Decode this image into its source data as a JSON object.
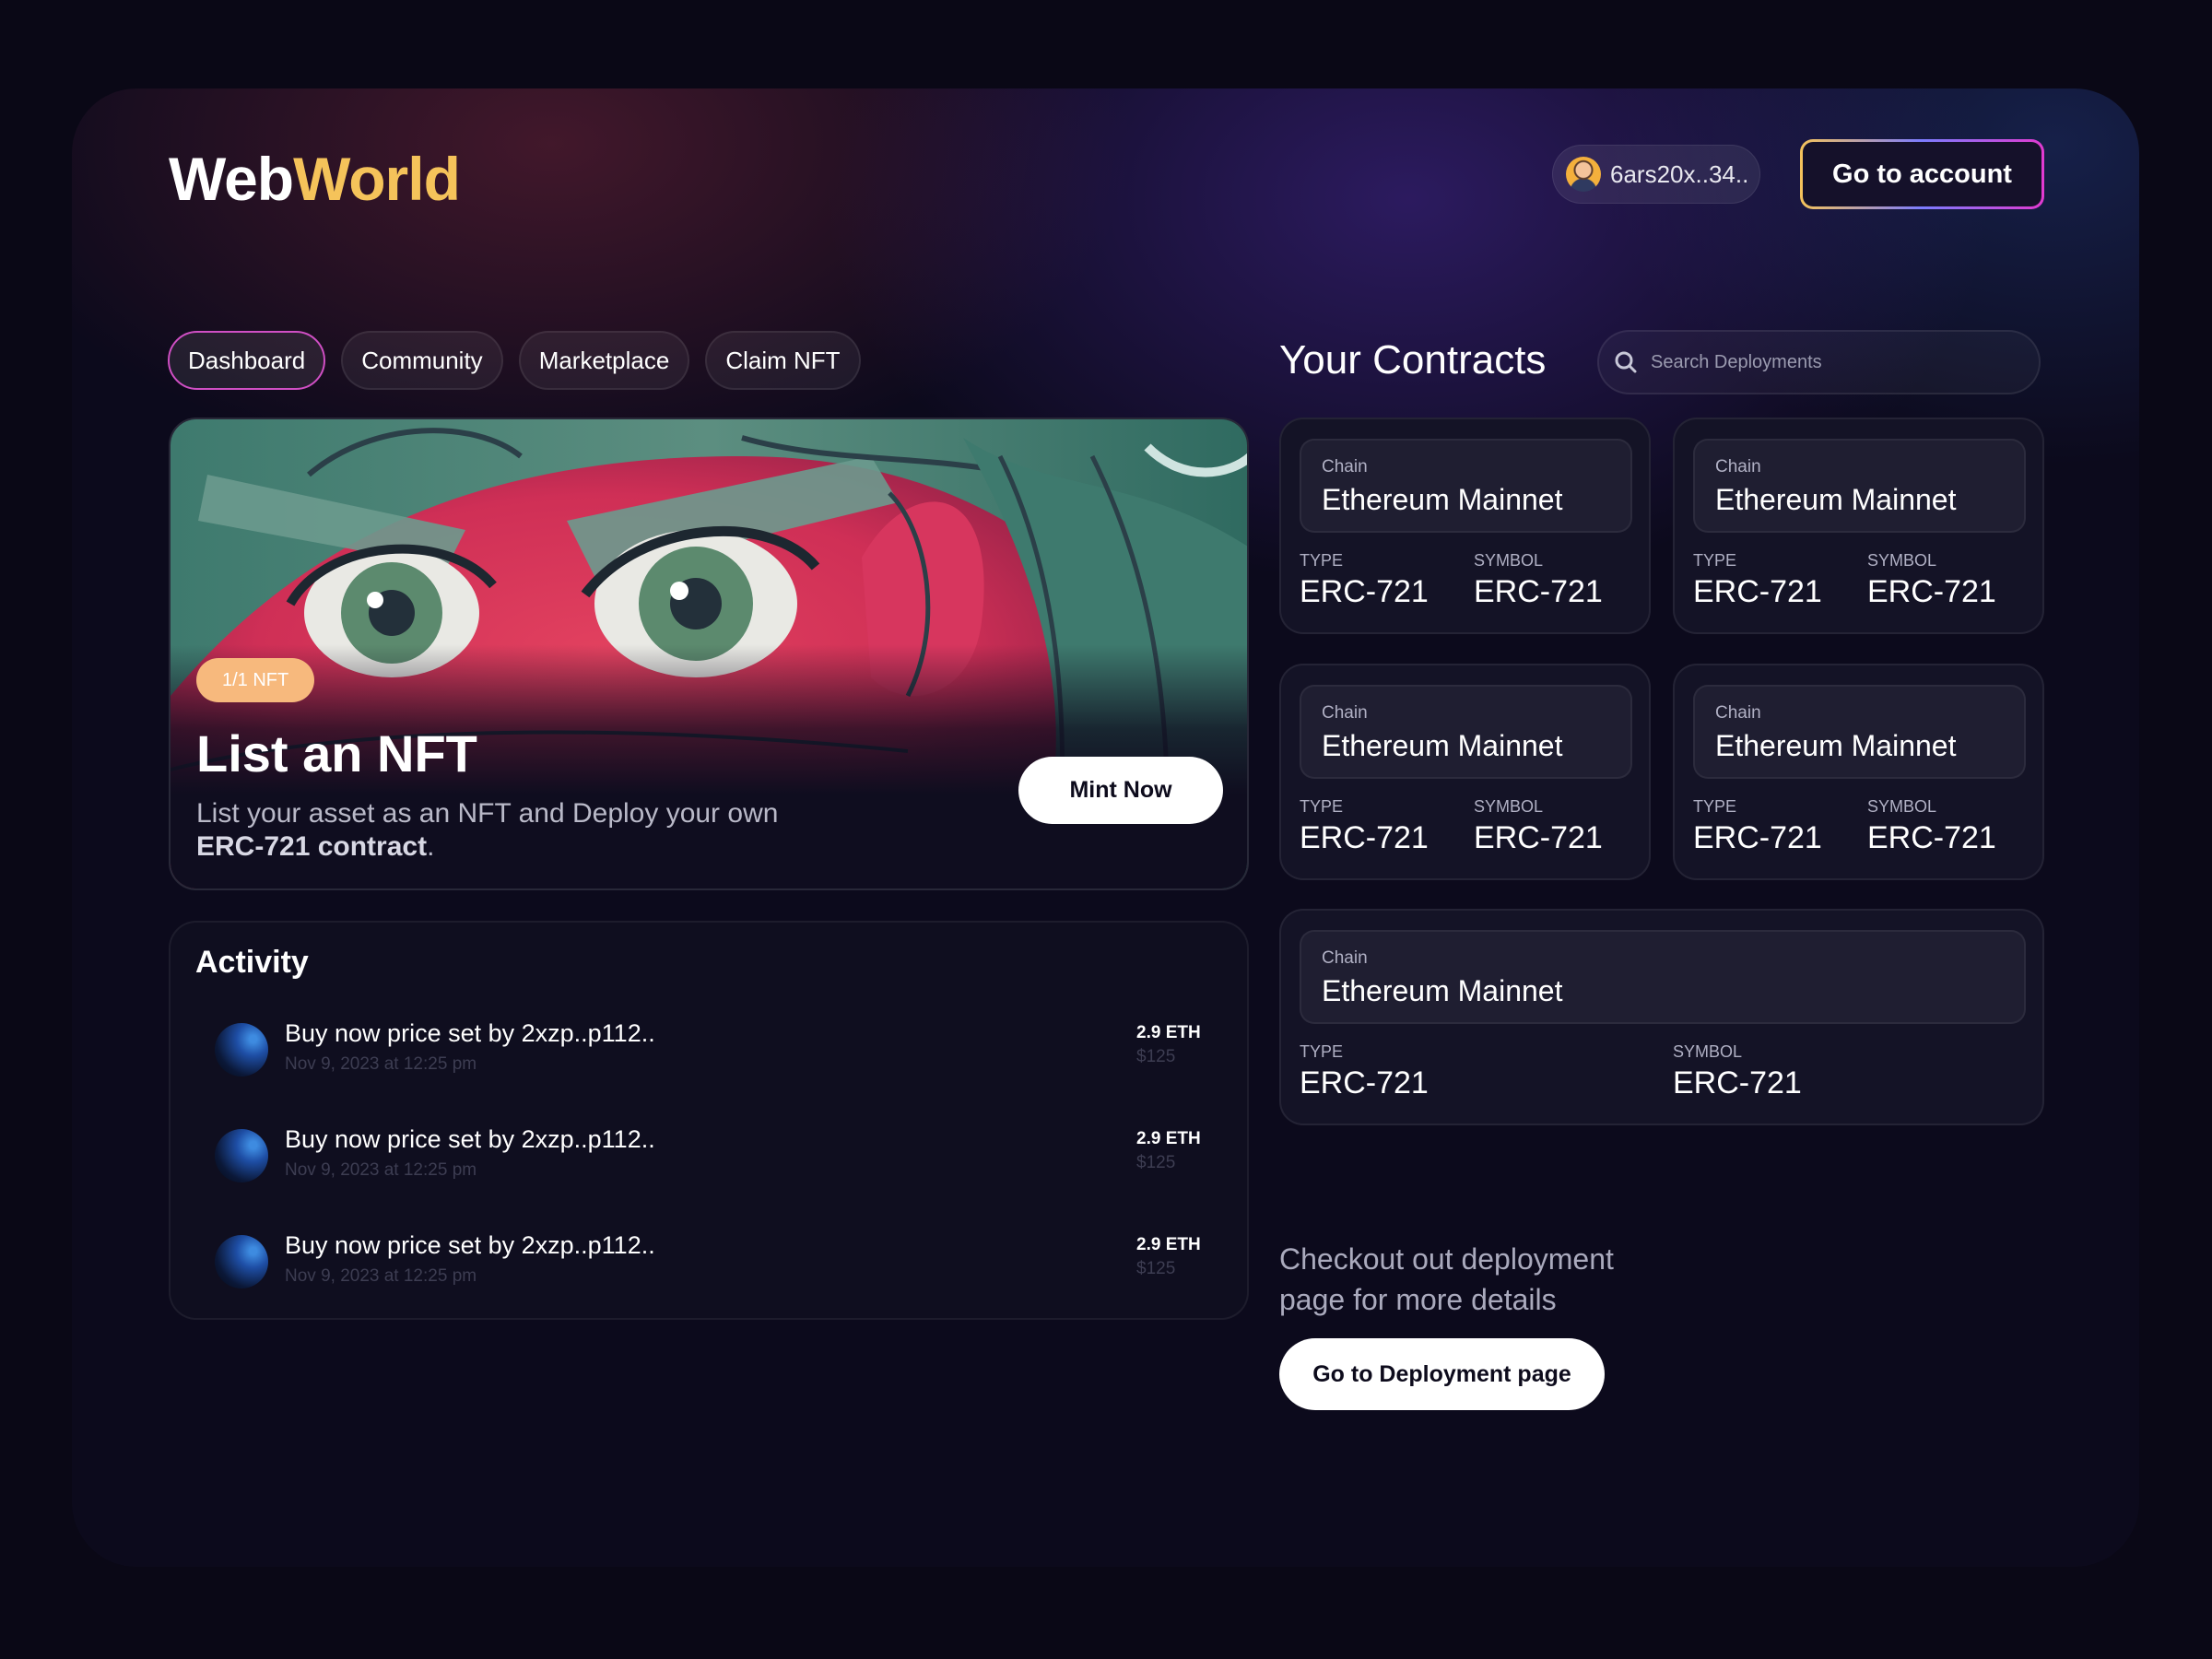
{
  "brand": {
    "part1": "Web",
    "part2": "World",
    "accent": "#f5c35a"
  },
  "header": {
    "wallet_address": "6ars20x..34..",
    "account_button": "Go to account"
  },
  "tabs": [
    {
      "label": "Dashboard",
      "active": true
    },
    {
      "label": "Community"
    },
    {
      "label": "Marketplace"
    },
    {
      "label": "Claim NFT"
    }
  ],
  "hero": {
    "badge": "1/1 NFT",
    "title": "List an NFT",
    "desc_text": "List your asset as an NFT and Deploy your own",
    "desc_bold": "ERC-721 contract",
    "desc_end": ".",
    "cta": "Mint Now"
  },
  "activity": {
    "title": "Activity",
    "items": [
      {
        "text": "Buy now price set by 2xzp..p112..",
        "date": "Nov 9,  2023 at 12:25 pm",
        "eth": "2.9 ETH",
        "usd": "$125"
      },
      {
        "text": "Buy now price set by 2xzp..p112..",
        "date": "Nov 9,  2023 at 12:25 pm",
        "eth": "2.9 ETH",
        "usd": "$125"
      },
      {
        "text": "Buy now price set by 2xzp..p112..",
        "date": "Nov 9,  2023 at 12:25 pm",
        "eth": "2.9 ETH",
        "usd": "$125"
      }
    ]
  },
  "contracts": {
    "title": "Your Contracts",
    "search_placeholder": "Search Deployments",
    "chain_label": "Chain",
    "type_label": "TYPE",
    "symbol_label": "SYMBOL",
    "items": [
      {
        "chain": "Ethereum Mainnet",
        "type": "ERC-721",
        "symbol": "ERC-721"
      },
      {
        "chain": "Ethereum Mainnet",
        "type": "ERC-721",
        "symbol": "ERC-721"
      },
      {
        "chain": "Ethereum Mainnet",
        "type": "ERC-721",
        "symbol": "ERC-721"
      },
      {
        "chain": "Ethereum Mainnet",
        "type": "ERC-721",
        "symbol": "ERC-721"
      },
      {
        "chain": "Ethereum Mainnet",
        "type": "ERC-721",
        "symbol": "ERC-721"
      }
    ],
    "checkout_text": "Checkout out deployment page for more details",
    "deploy_button": "Go to Deployment page"
  },
  "icons": {
    "search": "search-icon",
    "wallet_avatar": "avatar-icon",
    "activity_item": "orb-icon"
  }
}
